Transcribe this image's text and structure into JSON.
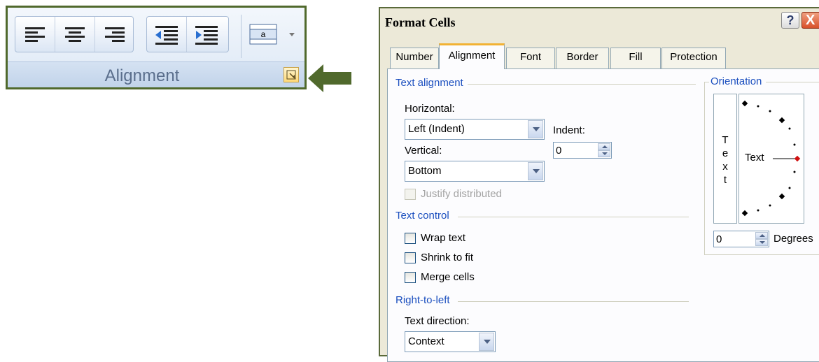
{
  "ribbon": {
    "group_label": "Alignment",
    "buttons": [
      "align-left",
      "align-center",
      "align-right",
      "decrease-indent",
      "increase-indent",
      "merge-center"
    ]
  },
  "dialog": {
    "title": "Format Cells",
    "help": "?",
    "close": "X",
    "tabs": [
      "Number",
      "Alignment",
      "Font",
      "Border",
      "Fill",
      "Protection"
    ],
    "active_tab": "Alignment",
    "text_alignment": {
      "section": "Text alignment",
      "horizontal_label": "Horizontal:",
      "horizontal_value": "Left (Indent)",
      "indent_label": "Indent:",
      "indent_value": "0",
      "vertical_label": "Vertical:",
      "vertical_value": "Bottom",
      "justify_distributed": "Justify distributed"
    },
    "text_control": {
      "section": "Text control",
      "wrap_text": "Wrap text",
      "shrink_to_fit": "Shrink to fit",
      "merge_cells": "Merge cells"
    },
    "right_to_left": {
      "section": "Right-to-left",
      "text_direction_label": "Text direction:",
      "text_direction_value": "Context"
    },
    "orientation": {
      "section": "Orientation",
      "vertical_text": [
        "T",
        "e",
        "x",
        "t"
      ],
      "dial_text": "Text",
      "degrees_value": "0",
      "degrees_label": "Degrees"
    }
  },
  "colors": {
    "arrow_green": "#50692c",
    "section_blue": "#1b4fbf"
  }
}
